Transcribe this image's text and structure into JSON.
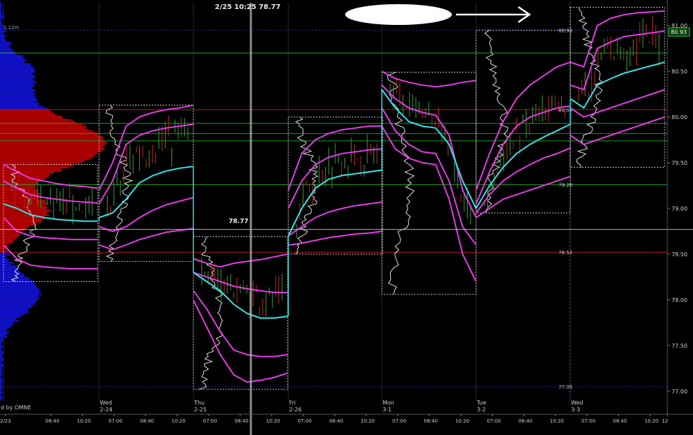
{
  "header": {
    "cursor_readout": "2/25 10:25 78.77",
    "volume_tag": "1.12m",
    "watermark": "d by OMNE"
  },
  "chart_data": {
    "type": "line",
    "ylim": [
      76.9,
      81.25
    ],
    "y_ticks": [
      "81.00",
      "80.50",
      "80.00",
      "79.50",
      "79.00",
      "78.50",
      "78.00",
      "77.50",
      "77.00"
    ],
    "y_tick_values": [
      81.0,
      80.5,
      80.0,
      79.5,
      79.0,
      78.5,
      78.0,
      77.5,
      77.0
    ],
    "last_price": "80.93",
    "last_price_value": 80.93,
    "cursor_price": "78.77",
    "cursor_price_value": 78.77,
    "colors": {
      "background": "#000000",
      "vwap": "#33e6e6",
      "bands": "#e63ce6",
      "grid_blue": "#2a2aa8",
      "profile_red": "#b00000",
      "profile_blue": "#1010c8",
      "up_bar": "#2e8b2e",
      "down_bar": "#a82020",
      "level_red": "#b41e1e",
      "level_green": "#1e9e1e",
      "crosshair": "#bbbbbb",
      "box": "#cfcfcf"
    },
    "sessions": [
      {
        "day": "",
        "date": "2/23",
        "range": [
          78.2,
          79.48
        ],
        "vwap": [
          79.05,
          79.0,
          78.93,
          78.9,
          78.88,
          78.87,
          78.86,
          78.86
        ],
        "bands": [
          [
            79.48,
            79.4,
            79.33,
            79.3,
            79.27,
            79.25,
            79.24,
            79.22
          ],
          [
            79.3,
            79.22,
            79.15,
            79.12,
            79.1,
            79.08,
            79.07,
            79.06
          ],
          [
            78.9,
            78.75,
            78.7,
            78.68,
            78.67,
            78.66,
            78.66,
            78.66
          ],
          [
            78.6,
            78.45,
            78.38,
            78.36,
            78.35,
            78.34,
            78.34,
            78.34
          ]
        ]
      },
      {
        "day": "Wed",
        "date": "2-24",
        "range": [
          78.42,
          80.13
        ],
        "vwap": [
          78.9,
          78.95,
          79.1,
          79.28,
          79.36,
          79.41,
          79.44,
          79.46
        ],
        "bands": [
          [
            79.2,
            79.5,
            79.9,
            80.0,
            80.05,
            80.08,
            80.1,
            80.13
          ],
          [
            79.05,
            79.3,
            79.7,
            79.8,
            79.85,
            79.88,
            79.9,
            79.92
          ],
          [
            78.8,
            78.75,
            78.8,
            78.9,
            78.98,
            79.04,
            79.08,
            79.12
          ],
          [
            78.6,
            78.55,
            78.6,
            78.66,
            78.7,
            78.74,
            78.76,
            78.78
          ]
        ]
      },
      {
        "day": "Thu",
        "date": "2-25",
        "range": [
          77.02,
          78.69
        ],
        "vwap": [
          78.3,
          78.2,
          78.1,
          77.95,
          77.85,
          77.8,
          77.8,
          77.82
        ],
        "bands": [
          [
            78.45,
            78.4,
            78.36,
            78.4,
            78.42,
            78.44,
            78.47,
            78.5
          ],
          [
            78.3,
            78.25,
            78.2,
            78.15,
            78.12,
            78.1,
            78.08,
            78.08
          ],
          [
            78.1,
            77.9,
            77.65,
            77.45,
            77.4,
            77.38,
            77.38,
            77.4
          ],
          [
            78.0,
            77.7,
            77.4,
            77.18,
            77.1,
            77.12,
            77.15,
            77.2
          ]
        ]
      },
      {
        "day": "Fri",
        "date": "2-26",
        "range": [
          78.5,
          80.0
        ],
        "vwap": [
          78.7,
          79.0,
          79.22,
          79.32,
          79.36,
          79.38,
          79.4,
          79.42
        ],
        "bands": [
          [
            79.2,
            79.6,
            79.75,
            79.82,
            79.86,
            79.88,
            79.9,
            79.9
          ],
          [
            79.0,
            79.3,
            79.48,
            79.56,
            79.6,
            79.62,
            79.64,
            79.65
          ],
          [
            78.7,
            78.8,
            78.9,
            78.96,
            79.0,
            79.03,
            79.05,
            79.07
          ],
          [
            78.6,
            78.62,
            78.65,
            78.68,
            78.7,
            78.72,
            78.73,
            78.75
          ]
        ]
      },
      {
        "day": "Mon",
        "date": "3-1",
        "range": [
          78.06,
          80.49
        ],
        "vwap": [
          80.3,
          80.1,
          79.95,
          79.9,
          79.88,
          79.7,
          79.3,
          79.0
        ],
        "bands": [
          [
            80.5,
            80.42,
            80.38,
            80.35,
            80.33,
            80.35,
            80.38,
            80.4
          ],
          [
            80.35,
            80.2,
            80.1,
            80.05,
            80.02,
            79.8,
            79.2,
            78.9
          ],
          [
            80.1,
            79.85,
            79.7,
            79.62,
            79.6,
            79.3,
            78.8,
            78.6
          ],
          [
            79.9,
            79.65,
            79.55,
            79.5,
            79.48,
            79.1,
            78.5,
            78.2
          ]
        ]
      },
      {
        "day": "Tue",
        "date": "3-2",
        "range": [
          78.95,
          80.95
        ],
        "vwap": [
          79.0,
          79.25,
          79.45,
          79.6,
          79.7,
          79.78,
          79.85,
          79.92
        ],
        "bands": [
          [
            79.2,
            79.6,
            79.95,
            80.2,
            80.35,
            80.45,
            80.55,
            80.6
          ],
          [
            79.05,
            79.4,
            79.7,
            79.9,
            80.0,
            80.05,
            80.1,
            80.12
          ],
          [
            78.95,
            79.15,
            79.3,
            79.4,
            79.48,
            79.55,
            79.6,
            79.66
          ],
          [
            78.9,
            79.0,
            79.1,
            79.15,
            79.2,
            79.25,
            79.3,
            79.35
          ]
        ]
      },
      {
        "day": "Wed",
        "date": "3-3",
        "range": [
          79.45,
          81.2
        ],
        "vwap": [
          80.2,
          80.1,
          80.35,
          80.42,
          80.48,
          80.52,
          80.56,
          80.6
        ],
        "bands": [
          [
            80.6,
            80.55,
            81.0,
            81.08,
            81.12,
            81.14,
            81.15,
            81.16
          ],
          [
            80.35,
            80.3,
            80.75,
            80.82,
            80.88,
            80.9,
            80.92,
            80.94
          ],
          [
            80.1,
            80.0,
            80.05,
            80.1,
            80.15,
            80.2,
            80.25,
            80.3
          ],
          [
            79.8,
            79.7,
            79.75,
            79.8,
            79.85,
            79.9,
            79.95,
            80.0
          ]
        ]
      }
    ],
    "levels": [
      {
        "label": "80.95",
        "value": 80.95,
        "color": "blue"
      },
      {
        "label": "80.08",
        "value": 80.08,
        "color": "red"
      },
      {
        "label": "79.26",
        "value": 79.26,
        "color": "green"
      },
      {
        "label": "78.52",
        "value": 78.52,
        "color": "red"
      },
      {
        "label": "77.05",
        "value": 77.05,
        "color": "blue"
      }
    ],
    "extra_levels": [
      {
        "value": 80.7,
        "color": "green"
      },
      {
        "value": 79.93,
        "color": "green"
      },
      {
        "value": 79.82,
        "color": "green"
      },
      {
        "value": 79.74,
        "color": "green"
      }
    ],
    "x_ticks": [
      "2/23",
      "08:40",
      "10:20",
      "07:00",
      "08:40",
      "10:20",
      "07:00",
      "08:40",
      "10:20",
      "07:00",
      "08:40",
      "10:20",
      "07:00",
      "08:40",
      "10:20",
      "07:00",
      "08:40",
      "10:20",
      "07:00",
      "08:40",
      "10:20",
      "12"
    ]
  }
}
